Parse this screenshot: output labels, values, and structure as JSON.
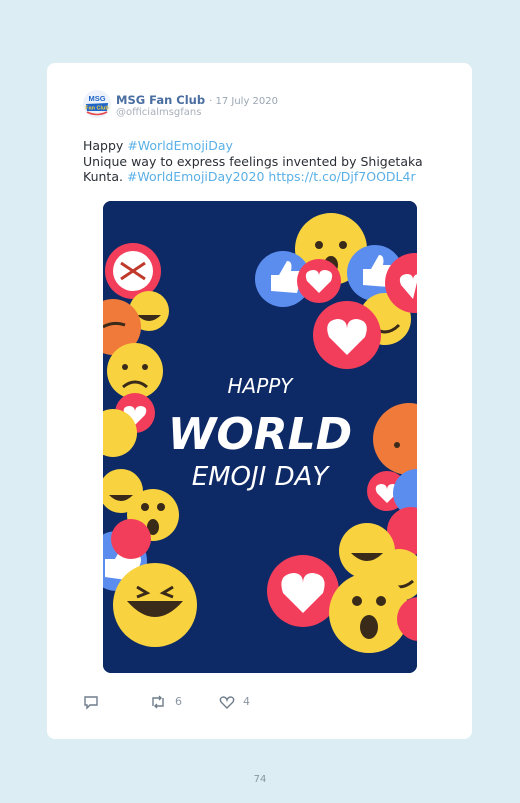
{
  "tweet": {
    "author_name": "MSG Fan Club",
    "date": "· 17 July 2020",
    "handle": "@officialmsgfans",
    "text": {
      "line1_prefix": "Happy ",
      "line1_hashtag": "#WorldEmojiDay",
      "line2": "Unique way to express feelings invented by Shigetaka Kunta. ",
      "hashtag2": "#WorldEmojiDay2020",
      "url": "https://t.co/Djf7OODL4r"
    },
    "avatar_text": {
      "top": "MSG",
      "bottom": "Fan Club"
    },
    "media": {
      "line1": "HAPPY",
      "line2": "WORLD",
      "line3": "EMOJI DAY",
      "background_color": "#0d2a66"
    },
    "actions": {
      "reply_icon": "reply-icon",
      "retweet_icon": "retweet-icon",
      "retweet_count": "6",
      "like_icon": "heart-icon",
      "like_count": "4"
    }
  },
  "page_number": "74",
  "colors": {
    "page_bg": "#dceef3",
    "card_bg": "#ffffff",
    "link": "#5ab0e6",
    "author": "#4a6ea0",
    "emoji_yellow": "#f8d33f",
    "reaction_red": "#f33e5b",
    "reaction_blue": "#5b8def"
  }
}
